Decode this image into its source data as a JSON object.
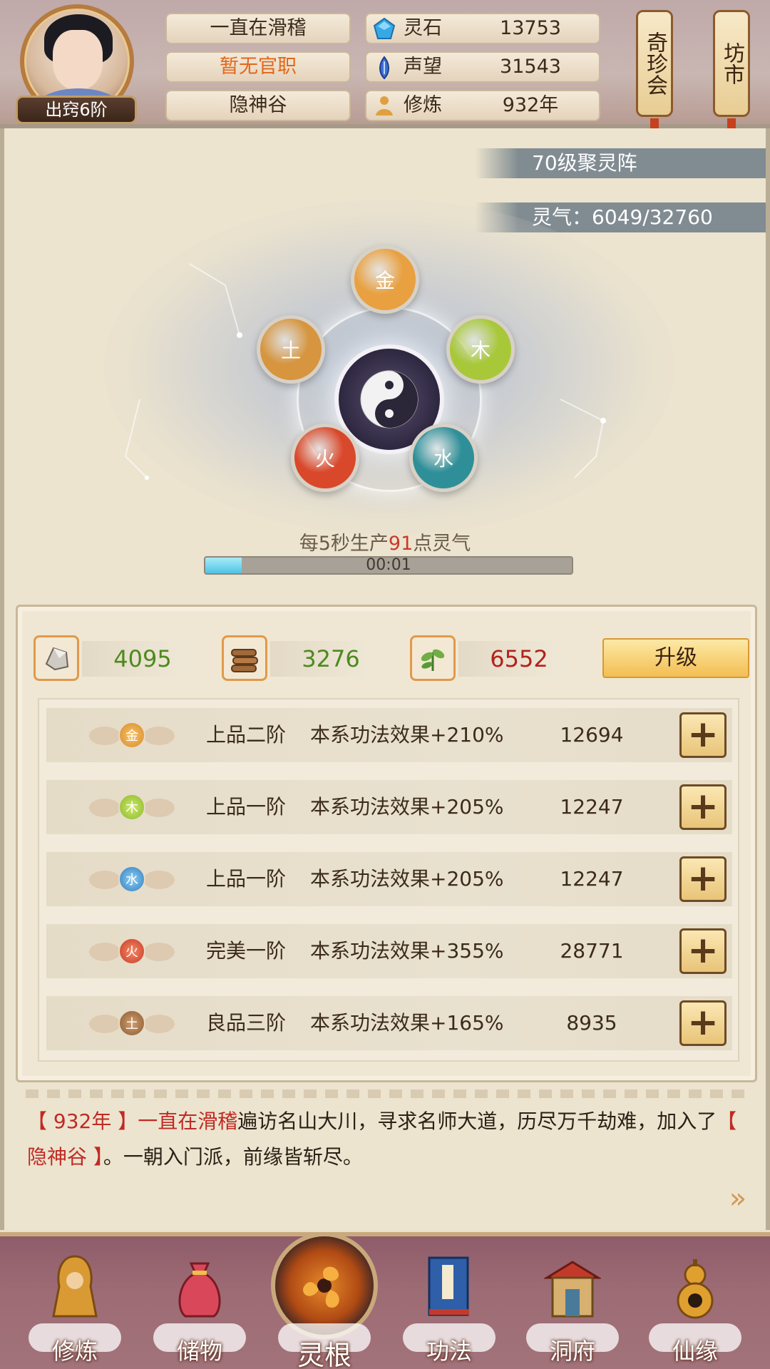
{
  "header": {
    "player_name": "一直在滑稽",
    "official_post": "暂无官职",
    "sect": "隐神谷",
    "rank": "出窍6阶",
    "resources": [
      {
        "label": "灵石",
        "value": "13753",
        "icon": "spirit-stone-icon",
        "color": "#36a8e6"
      },
      {
        "label": "声望",
        "value": "31543",
        "icon": "prestige-crystal-icon",
        "color": "#3d6fd9"
      },
      {
        "label": "修炼",
        "value": "932年",
        "icon": "meditation-icon",
        "color": "#e0a040"
      }
    ],
    "side_buttons": [
      {
        "label": "奇珍会"
      },
      {
        "label": "坊市"
      }
    ]
  },
  "array": {
    "name": "70级聚灵阵",
    "spirit_label": "灵气：6049/32760",
    "production_prefix": "每5秒生产",
    "production_value": "91",
    "production_suffix": "点灵气",
    "timer": "00:01",
    "progress_fraction": 0.1,
    "elements": [
      {
        "label": "金",
        "color": "#e8a040"
      },
      {
        "label": "木",
        "color": "#a8c83a"
      },
      {
        "label": "水",
        "color": "#2f8f98"
      },
      {
        "label": "火",
        "color": "#d9482a"
      },
      {
        "label": "土",
        "color": "#d6953e"
      }
    ]
  },
  "materials": [
    {
      "icon": "ore-icon",
      "value": "4095",
      "color": "#4d8a1e"
    },
    {
      "icon": "wood-icon",
      "value": "3276",
      "color": "#4d8a1e"
    },
    {
      "icon": "herb-icon",
      "value": "6552",
      "color": "#b2221c"
    }
  ],
  "upgrade_label": "升级",
  "roots": [
    {
      "element": "金",
      "grade": "上品二阶",
      "effect": "本系功法效果+210%",
      "value": "12694",
      "color": "#e8a040"
    },
    {
      "element": "木",
      "grade": "上品一阶",
      "effect": "本系功法效果+205%",
      "value": "12247",
      "color": "#9cc23a"
    },
    {
      "element": "水",
      "grade": "上品一阶",
      "effect": "本系功法效果+205%",
      "value": "12247",
      "color": "#3a8ec8"
    },
    {
      "element": "火",
      "grade": "完美一阶",
      "effect": "本系功法效果+355%",
      "value": "28771",
      "color": "#d9482a"
    },
    {
      "element": "土",
      "grade": "良品三阶",
      "effect": "本系功法效果+165%",
      "value": "8935",
      "color": "#a87a4a"
    }
  ],
  "story": {
    "year": "【 932年 】",
    "name": "一直在滑稽",
    "text1": "遍访名山大川，寻求名师大道，历尽万千劫难，加入了",
    "sect": "【 隐神谷 】",
    "text2": "。一朝入门派，前缘皆斩尽。"
  },
  "nav": [
    {
      "label": "修炼",
      "icon": "meditation-monk-icon"
    },
    {
      "label": "储物",
      "icon": "storage-bag-icon"
    },
    {
      "label": "灵根",
      "icon": "spirit-root-icon"
    },
    {
      "label": "功法",
      "icon": "scripture-book-icon"
    },
    {
      "label": "洞府",
      "icon": "cave-mansion-icon"
    },
    {
      "label": "仙缘",
      "icon": "gourd-icon"
    }
  ]
}
